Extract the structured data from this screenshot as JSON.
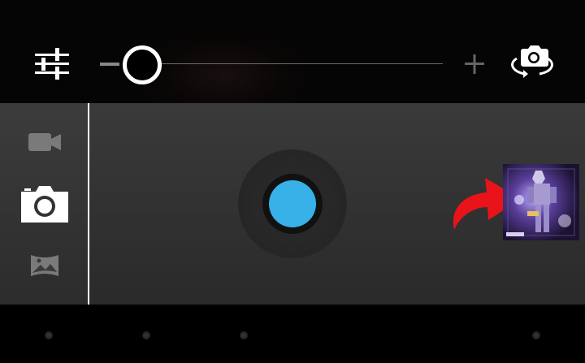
{
  "zoom": {
    "minus_icon": "minus-icon",
    "plus_icon": "plus-icon",
    "level": 0
  },
  "toolbar": {
    "settings_icon": "sliders-icon",
    "switch_camera_icon": "camera-switch-icon"
  },
  "modes": [
    {
      "name": "video",
      "icon": "video-camera-icon",
      "active": false
    },
    {
      "name": "photo",
      "icon": "camera-icon",
      "active": true
    },
    {
      "name": "panorama",
      "icon": "panorama-icon",
      "active": false
    }
  ],
  "shutter": {
    "color": "#37b1e8"
  },
  "annotation": {
    "arrow_color": "#e8141a"
  },
  "colors": {
    "accent": "#37b1e8",
    "sidebar_divider": "#ffffff"
  }
}
